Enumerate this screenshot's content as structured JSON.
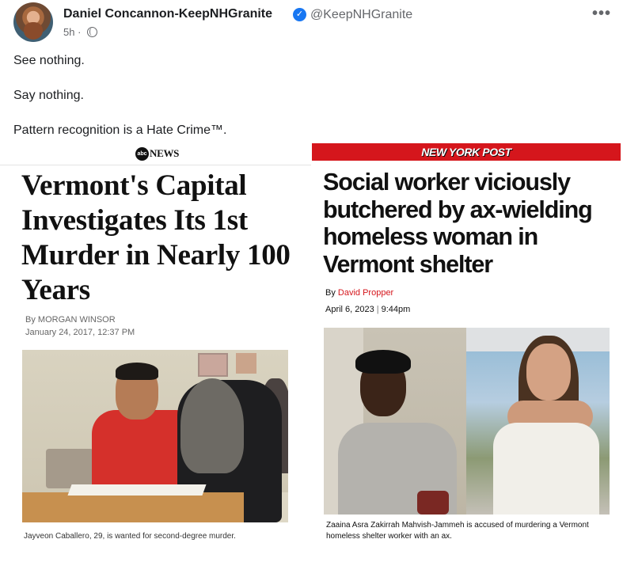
{
  "post": {
    "author_name": "Daniel Concannon-KeepNHGranite",
    "handle": "@KeepNHGranite",
    "timestamp": "5h",
    "meta_separator": "·",
    "privacy_icon": "globe-icon",
    "verified_icon": "verified-badge-icon",
    "more_label": "•••",
    "lines": [
      "See nothing.",
      "Say nothing.",
      "Pattern recognition is a Hate Crime™."
    ]
  },
  "abc_article": {
    "logo_circle": "abc",
    "logo_text": "NEWS",
    "headline": "Vermont's Capital Investigates Its 1st Murder in Nearly 100 Years",
    "byline_prefix": "By ",
    "author": "MORGAN WINSOR",
    "date": "January 24, 2017, 12:37 PM",
    "caption": "Jayveon Caballero, 29, is wanted for second-degree murder."
  },
  "nyp_article": {
    "logo": "NEW YORK POST",
    "brand_color": "#d5161c",
    "headline": "Social worker viciously butchered by ax-wielding homeless woman in Vermont shelter",
    "byline_prefix": "By ",
    "author": "David Propper",
    "date": "April 6, 2023",
    "separator": "|",
    "time": "9:44pm",
    "caption": "Zaaina Asra Zakirrah Mahvish-Jammeh is accused of murdering a Vermont homeless shelter worker with an ax."
  }
}
